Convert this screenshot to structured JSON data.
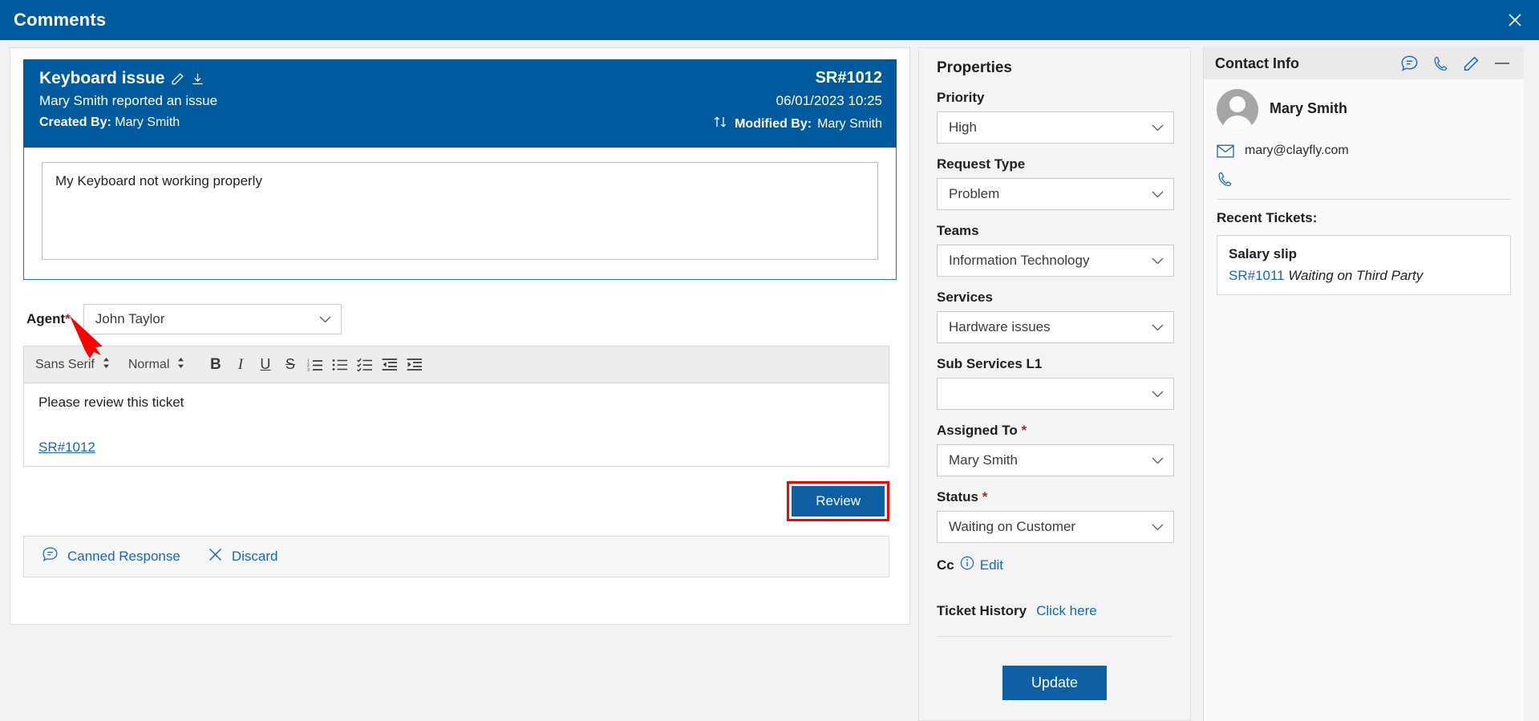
{
  "window": {
    "title": "Comments",
    "close_icon": "close-icon",
    "accent": "#005a9e"
  },
  "ticket": {
    "title": "Keyboard issue",
    "edit_icon": "pencil-icon",
    "download_icon": "download-icon",
    "sr_number": "SR#1012",
    "subtitle": "Mary Smith reported an issue",
    "date": "06/01/2023 10:25",
    "created_by_label": "Created By:",
    "created_by": "Mary Smith",
    "sort_icon": "sort-arrows-icon",
    "modified_by_label": "Modified By:",
    "modified_by": "Mary Smith",
    "description": "My Keyboard not working properly"
  },
  "agent": {
    "label": "Agent",
    "required": "*",
    "value": "John Taylor"
  },
  "editor": {
    "font_family": "Sans Serif",
    "font_size": "Normal",
    "buttons": [
      {
        "name": "bold-button",
        "label": "B"
      },
      {
        "name": "italic-button",
        "label": "I"
      },
      {
        "name": "underline-button",
        "label": "U"
      },
      {
        "name": "strikethrough-button",
        "label": "S"
      }
    ],
    "list_buttons": [
      "ordered-list-button",
      "bullet-list-button",
      "check-list-button",
      "outdent-button",
      "indent-button"
    ],
    "body_text": "Please review this ticket",
    "link_text": "SR#1012"
  },
  "review_button": {
    "label": "Review"
  },
  "actions": [
    {
      "name": "canned-response-button",
      "label": "Canned Response",
      "icon": "comment-icon"
    },
    {
      "name": "discard-button",
      "label": "Discard",
      "icon": "close-icon"
    }
  ],
  "properties": {
    "title": "Properties",
    "fields": [
      {
        "name": "priority",
        "label": "Priority",
        "required": false,
        "value": "High"
      },
      {
        "name": "request-type",
        "label": "Request Type",
        "required": false,
        "value": "Problem"
      },
      {
        "name": "teams",
        "label": "Teams",
        "required": false,
        "value": "Information Technology"
      },
      {
        "name": "services",
        "label": "Services",
        "required": false,
        "value": "Hardware issues"
      },
      {
        "name": "sub-services-l1",
        "label": "Sub Services L1",
        "required": false,
        "value": ""
      },
      {
        "name": "assigned-to",
        "label": "Assigned To",
        "required": true,
        "value": "Mary Smith"
      },
      {
        "name": "status",
        "label": "Status",
        "required": true,
        "value": "Waiting on Customer"
      }
    ],
    "required_mark": "*",
    "cc_label": "Cc",
    "cc_info_icon": "info-icon",
    "cc_edit_label": "Edit",
    "history_label": "Ticket History",
    "history_link": "Click here",
    "update_label": "Update"
  },
  "contact": {
    "title": "Contact Info",
    "header_icons": [
      "comment-icon",
      "phone-icon",
      "pencil-icon",
      "minimize-icon"
    ],
    "name": "Mary Smith",
    "email": "mary@clayfly.com",
    "email_icon": "mail-icon",
    "phone": "",
    "phone_icon": "phone-icon",
    "recent_title": "Recent Tickets:",
    "recent_tickets": [
      {
        "title": "Salary slip",
        "sr": "SR#1011",
        "status": "Waiting on Third Party"
      }
    ]
  },
  "annotation": {
    "arrow_color": "#ff0000",
    "highlight_color": "#ff0000"
  }
}
